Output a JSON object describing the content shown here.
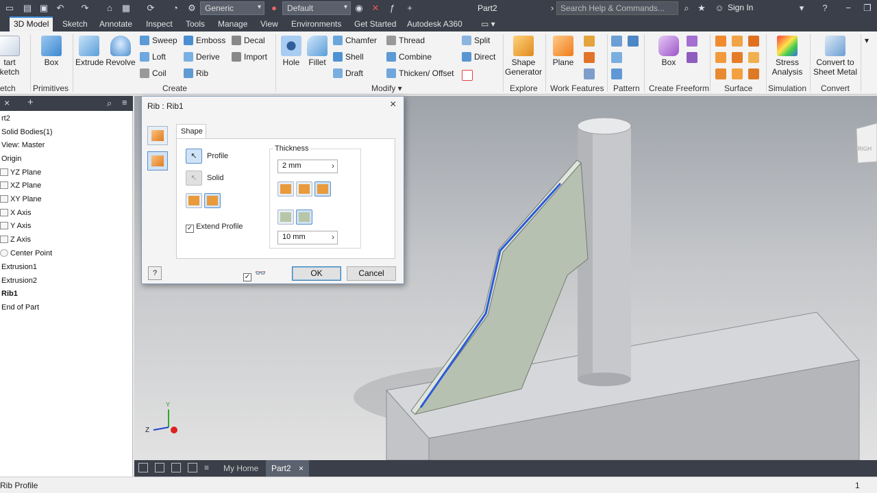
{
  "titlebar": {
    "material": "Generic",
    "appearance": "Default",
    "doc_title": "Part2",
    "search_placeholder": "Search Help & Commands...",
    "signin": "Sign In"
  },
  "tabs": [
    "3D Model",
    "Sketch",
    "Annotate",
    "Inspect",
    "Tools",
    "Manage",
    "View",
    "Environments",
    "Get Started",
    "Autodesk A360"
  ],
  "ribbon": {
    "sketch": {
      "start": "tart",
      "sketch": "ketch",
      "group": "etch"
    },
    "primitives": {
      "box": "Box",
      "group": "Primitives"
    },
    "create": {
      "extrude": "Extrude",
      "revolve": "Revolve",
      "sweep": "Sweep",
      "loft": "Loft",
      "coil": "Coil",
      "emboss": "Emboss",
      "derive": "Derive",
      "rib": "Rib",
      "decal": "Decal",
      "import": "Import",
      "group": "Create"
    },
    "modify": {
      "hole": "Hole",
      "fillet": "Fillet",
      "chamfer": "Chamfer",
      "shell": "Shell",
      "draft": "Draft",
      "thread": "Thread",
      "combine": "Combine",
      "thicken": "Thicken/ Offset",
      "split": "Split",
      "direct": "Direct",
      "group": "Modify"
    },
    "explore": {
      "shape1": "Shape",
      "shape2": "Generator",
      "group": "Explore"
    },
    "work": {
      "plane": "Plane",
      "group": "Work Features"
    },
    "pattern": {
      "group": "Pattern"
    },
    "freeform": {
      "box": "Box",
      "group": "Create Freeform"
    },
    "surface": {
      "group": "Surface"
    },
    "simulation": {
      "l1": "Stress",
      "l2": "Analysis",
      "group": "Simulation"
    },
    "convert": {
      "l1": "Convert to",
      "l2": "Sheet Metal",
      "group": "Convert"
    }
  },
  "browser": {
    "items": [
      "rt2",
      "Solid Bodies(1)",
      "View: Master",
      "Origin",
      "YZ Plane",
      "XZ Plane",
      "XY Plane",
      "X Axis",
      "Y Axis",
      "Z Axis",
      "Center Point",
      "Extrusion1",
      "Extrusion2",
      "Rib1",
      "End of Part"
    ]
  },
  "dialog": {
    "title": "Rib : Rib1",
    "tab_shape": "Shape",
    "profile_label": "Profile",
    "solid_label": "Solid",
    "extend_profile": "Extend Profile",
    "thickness_label": "Thickness",
    "thickness_value": "2 mm",
    "extent_value": "10 mm",
    "ok": "OK",
    "cancel": "Cancel"
  },
  "doc_tabs": [
    "My Home",
    "Part2"
  ],
  "status": {
    "text": "Rib Profile",
    "count": "1"
  },
  "viewcube": {
    "face": "RIGH"
  },
  "colors": {
    "accent": "#3b8ad9",
    "dark_chrome": "#3a3f49",
    "rib_face": "#b6c1b2",
    "highlight": "#f7e600"
  }
}
